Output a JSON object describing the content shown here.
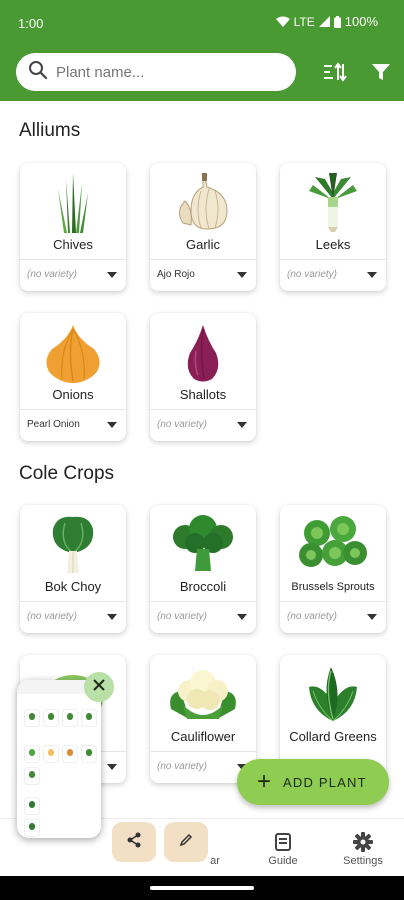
{
  "status_bar": {
    "time": "1:00",
    "network": "LTE",
    "battery": "100%"
  },
  "search": {
    "placeholder": "Plant name..."
  },
  "sections": [
    {
      "title": "Alliums"
    },
    {
      "title": "Cole Crops"
    }
  ],
  "plants": {
    "chives": {
      "name": "Chives",
      "variety": "(no variety)"
    },
    "garlic": {
      "name": "Garlic",
      "variety": "Ajo Rojo"
    },
    "leeks": {
      "name": "Leeks",
      "variety": "(no variety)"
    },
    "onions": {
      "name": "Onions",
      "variety": "Pearl Onion"
    },
    "shallots": {
      "name": "Shallots",
      "variety": "(no variety)"
    },
    "bok_choy": {
      "name": "Bok Choy",
      "variety": "(no variety)"
    },
    "broccoli": {
      "name": "Broccoli",
      "variety": "(no variety)"
    },
    "brussels": {
      "name": "Brussels Sprouts",
      "variety": "(no variety)"
    },
    "cauliflower": {
      "name": "Cauliflower",
      "variety": "(no variety)"
    },
    "collard": {
      "name": "Collard Greens",
      "variety": ""
    }
  },
  "fab": {
    "label": "ADD PLANT"
  },
  "bottom_nav": [
    {
      "label": "ar"
    },
    {
      "label": "Guide"
    },
    {
      "label": "Settings"
    }
  ],
  "colors": {
    "header": "#4a9a33",
    "fab": "#8fcc52",
    "accent_overlay": "#b9e0a6",
    "overlay_button": "#f3dfc4"
  },
  "icons": [
    "search-icon",
    "sort-icon",
    "filter-icon",
    "share-icon",
    "edit-icon",
    "close-icon",
    "guide-icon",
    "settings-icon"
  ]
}
